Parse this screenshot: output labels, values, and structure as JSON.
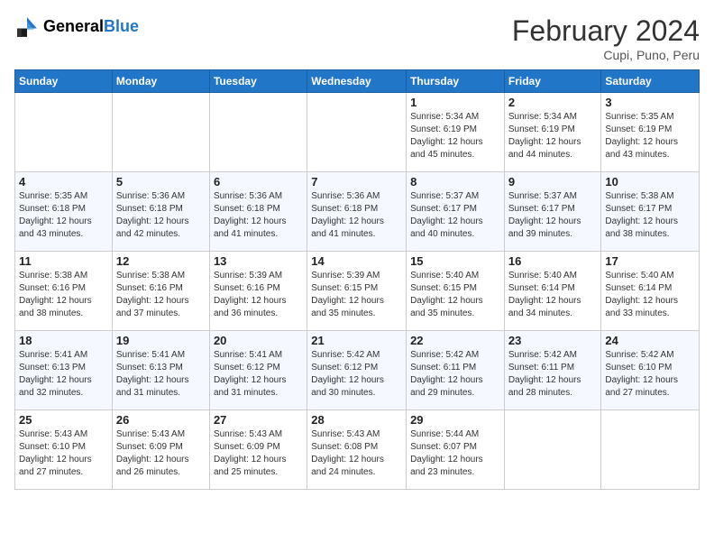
{
  "header": {
    "logo_line1": "General",
    "logo_line2": "Blue",
    "month_title": "February 2024",
    "location": "Cupi, Puno, Peru"
  },
  "days_of_week": [
    "Sunday",
    "Monday",
    "Tuesday",
    "Wednesday",
    "Thursday",
    "Friday",
    "Saturday"
  ],
  "weeks": [
    [
      {
        "day": "",
        "info": ""
      },
      {
        "day": "",
        "info": ""
      },
      {
        "day": "",
        "info": ""
      },
      {
        "day": "",
        "info": ""
      },
      {
        "day": "1",
        "info": "Sunrise: 5:34 AM\nSunset: 6:19 PM\nDaylight: 12 hours\nand 45 minutes."
      },
      {
        "day": "2",
        "info": "Sunrise: 5:34 AM\nSunset: 6:19 PM\nDaylight: 12 hours\nand 44 minutes."
      },
      {
        "day": "3",
        "info": "Sunrise: 5:35 AM\nSunset: 6:19 PM\nDaylight: 12 hours\nand 43 minutes."
      }
    ],
    [
      {
        "day": "4",
        "info": "Sunrise: 5:35 AM\nSunset: 6:18 PM\nDaylight: 12 hours\nand 43 minutes."
      },
      {
        "day": "5",
        "info": "Sunrise: 5:36 AM\nSunset: 6:18 PM\nDaylight: 12 hours\nand 42 minutes."
      },
      {
        "day": "6",
        "info": "Sunrise: 5:36 AM\nSunset: 6:18 PM\nDaylight: 12 hours\nand 41 minutes."
      },
      {
        "day": "7",
        "info": "Sunrise: 5:36 AM\nSunset: 6:18 PM\nDaylight: 12 hours\nand 41 minutes."
      },
      {
        "day": "8",
        "info": "Sunrise: 5:37 AM\nSunset: 6:17 PM\nDaylight: 12 hours\nand 40 minutes."
      },
      {
        "day": "9",
        "info": "Sunrise: 5:37 AM\nSunset: 6:17 PM\nDaylight: 12 hours\nand 39 minutes."
      },
      {
        "day": "10",
        "info": "Sunrise: 5:38 AM\nSunset: 6:17 PM\nDaylight: 12 hours\nand 38 minutes."
      }
    ],
    [
      {
        "day": "11",
        "info": "Sunrise: 5:38 AM\nSunset: 6:16 PM\nDaylight: 12 hours\nand 38 minutes."
      },
      {
        "day": "12",
        "info": "Sunrise: 5:38 AM\nSunset: 6:16 PM\nDaylight: 12 hours\nand 37 minutes."
      },
      {
        "day": "13",
        "info": "Sunrise: 5:39 AM\nSunset: 6:16 PM\nDaylight: 12 hours\nand 36 minutes."
      },
      {
        "day": "14",
        "info": "Sunrise: 5:39 AM\nSunset: 6:15 PM\nDaylight: 12 hours\nand 35 minutes."
      },
      {
        "day": "15",
        "info": "Sunrise: 5:40 AM\nSunset: 6:15 PM\nDaylight: 12 hours\nand 35 minutes."
      },
      {
        "day": "16",
        "info": "Sunrise: 5:40 AM\nSunset: 6:14 PM\nDaylight: 12 hours\nand 34 minutes."
      },
      {
        "day": "17",
        "info": "Sunrise: 5:40 AM\nSunset: 6:14 PM\nDaylight: 12 hours\nand 33 minutes."
      }
    ],
    [
      {
        "day": "18",
        "info": "Sunrise: 5:41 AM\nSunset: 6:13 PM\nDaylight: 12 hours\nand 32 minutes."
      },
      {
        "day": "19",
        "info": "Sunrise: 5:41 AM\nSunset: 6:13 PM\nDaylight: 12 hours\nand 31 minutes."
      },
      {
        "day": "20",
        "info": "Sunrise: 5:41 AM\nSunset: 6:12 PM\nDaylight: 12 hours\nand 31 minutes."
      },
      {
        "day": "21",
        "info": "Sunrise: 5:42 AM\nSunset: 6:12 PM\nDaylight: 12 hours\nand 30 minutes."
      },
      {
        "day": "22",
        "info": "Sunrise: 5:42 AM\nSunset: 6:11 PM\nDaylight: 12 hours\nand 29 minutes."
      },
      {
        "day": "23",
        "info": "Sunrise: 5:42 AM\nSunset: 6:11 PM\nDaylight: 12 hours\nand 28 minutes."
      },
      {
        "day": "24",
        "info": "Sunrise: 5:42 AM\nSunset: 6:10 PM\nDaylight: 12 hours\nand 27 minutes."
      }
    ],
    [
      {
        "day": "25",
        "info": "Sunrise: 5:43 AM\nSunset: 6:10 PM\nDaylight: 12 hours\nand 27 minutes."
      },
      {
        "day": "26",
        "info": "Sunrise: 5:43 AM\nSunset: 6:09 PM\nDaylight: 12 hours\nand 26 minutes."
      },
      {
        "day": "27",
        "info": "Sunrise: 5:43 AM\nSunset: 6:09 PM\nDaylight: 12 hours\nand 25 minutes."
      },
      {
        "day": "28",
        "info": "Sunrise: 5:43 AM\nSunset: 6:08 PM\nDaylight: 12 hours\nand 24 minutes."
      },
      {
        "day": "29",
        "info": "Sunrise: 5:44 AM\nSunset: 6:07 PM\nDaylight: 12 hours\nand 23 minutes."
      },
      {
        "day": "",
        "info": ""
      },
      {
        "day": "",
        "info": ""
      }
    ]
  ]
}
